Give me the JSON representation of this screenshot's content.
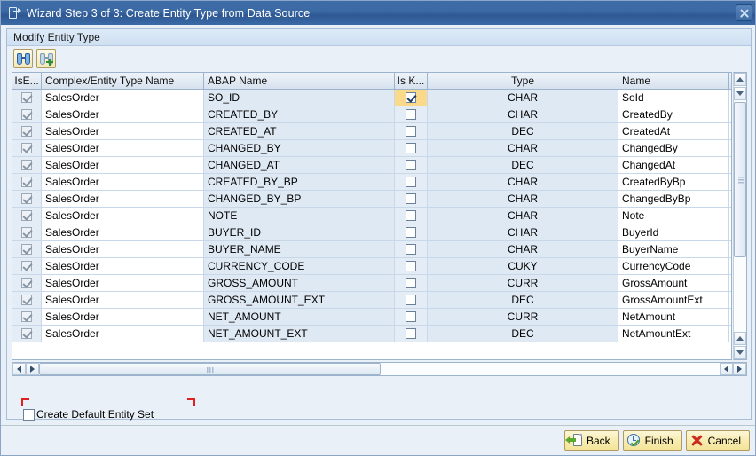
{
  "window": {
    "title": "Wizard Step 3 of 3: Create Entity Type from Data Source",
    "title_icon": "wizard-page-icon",
    "close_label": "×"
  },
  "panel": {
    "header": "Modify Entity Type"
  },
  "toolbar": {
    "buttons": [
      {
        "name": "find-button",
        "icon": "binoculars-icon",
        "tooltip": "Find"
      },
      {
        "name": "find-next-button",
        "icon": "binoculars-plus-icon",
        "tooltip": "Find Next"
      }
    ]
  },
  "grid": {
    "columns": [
      {
        "key": "is_entity",
        "label": "IsE...",
        "align": "center"
      },
      {
        "key": "complex_entity_type_name",
        "label": "Complex/Entity Type Name",
        "align": "left"
      },
      {
        "key": "abap_name",
        "label": "ABAP Name",
        "align": "left"
      },
      {
        "key": "is_key",
        "label": "Is K...",
        "align": "center"
      },
      {
        "key": "type",
        "label": "Type",
        "align": "center"
      },
      {
        "key": "name",
        "label": "Name",
        "align": "left"
      }
    ],
    "rows": [
      {
        "is_entity": true,
        "complex_entity_type_name": "SalesOrder",
        "abap_name": "SO_ID",
        "is_key": true,
        "type": "CHAR",
        "name": "SoId",
        "selected": true
      },
      {
        "is_entity": true,
        "complex_entity_type_name": "SalesOrder",
        "abap_name": "CREATED_BY",
        "is_key": false,
        "type": "CHAR",
        "name": "CreatedBy",
        "selected": false
      },
      {
        "is_entity": true,
        "complex_entity_type_name": "SalesOrder",
        "abap_name": "CREATED_AT",
        "is_key": false,
        "type": "DEC",
        "name": "CreatedAt",
        "selected": false
      },
      {
        "is_entity": true,
        "complex_entity_type_name": "SalesOrder",
        "abap_name": "CHANGED_BY",
        "is_key": false,
        "type": "CHAR",
        "name": "ChangedBy",
        "selected": false
      },
      {
        "is_entity": true,
        "complex_entity_type_name": "SalesOrder",
        "abap_name": "CHANGED_AT",
        "is_key": false,
        "type": "DEC",
        "name": "ChangedAt",
        "selected": false
      },
      {
        "is_entity": true,
        "complex_entity_type_name": "SalesOrder",
        "abap_name": "CREATED_BY_BP",
        "is_key": false,
        "type": "CHAR",
        "name": "CreatedByBp",
        "selected": false
      },
      {
        "is_entity": true,
        "complex_entity_type_name": "SalesOrder",
        "abap_name": "CHANGED_BY_BP",
        "is_key": false,
        "type": "CHAR",
        "name": "ChangedByBp",
        "selected": false
      },
      {
        "is_entity": true,
        "complex_entity_type_name": "SalesOrder",
        "abap_name": "NOTE",
        "is_key": false,
        "type": "CHAR",
        "name": "Note",
        "selected": false
      },
      {
        "is_entity": true,
        "complex_entity_type_name": "SalesOrder",
        "abap_name": "BUYER_ID",
        "is_key": false,
        "type": "CHAR",
        "name": "BuyerId",
        "selected": false
      },
      {
        "is_entity": true,
        "complex_entity_type_name": "SalesOrder",
        "abap_name": "BUYER_NAME",
        "is_key": false,
        "type": "CHAR",
        "name": "BuyerName",
        "selected": false
      },
      {
        "is_entity": true,
        "complex_entity_type_name": "SalesOrder",
        "abap_name": "CURRENCY_CODE",
        "is_key": false,
        "type": "CUKY",
        "name": "CurrencyCode",
        "selected": false
      },
      {
        "is_entity": true,
        "complex_entity_type_name": "SalesOrder",
        "abap_name": "GROSS_AMOUNT",
        "is_key": false,
        "type": "CURR",
        "name": "GrossAmount",
        "selected": false
      },
      {
        "is_entity": true,
        "complex_entity_type_name": "SalesOrder",
        "abap_name": "GROSS_AMOUNT_EXT",
        "is_key": false,
        "type": "DEC",
        "name": "GrossAmountExt",
        "selected": false
      },
      {
        "is_entity": true,
        "complex_entity_type_name": "SalesOrder",
        "abap_name": "NET_AMOUNT",
        "is_key": false,
        "type": "CURR",
        "name": "NetAmount",
        "selected": false
      },
      {
        "is_entity": true,
        "complex_entity_type_name": "SalesOrder",
        "abap_name": "NET_AMOUNT_EXT",
        "is_key": false,
        "type": "DEC",
        "name": "NetAmountExt",
        "selected": false
      }
    ]
  },
  "options": {
    "create_default_entity_set": {
      "label": "Create Default Entity Set",
      "checked": false
    }
  },
  "footer": {
    "buttons": [
      {
        "name": "back-button",
        "label": "Back",
        "icon": "page-back-icon"
      },
      {
        "name": "finish-button",
        "label": "Finish",
        "icon": "clock-check-icon"
      },
      {
        "name": "cancel-button",
        "label": "Cancel",
        "icon": "red-x-icon"
      }
    ]
  },
  "colors": {
    "titlebar": "#2e5894",
    "panel_bg": "#eaf0f8",
    "grid_row_alt": "#dfe9f4",
    "selected_cell": "#fbd98a",
    "focus_bracket": "#e02020",
    "button_yellow": "#f3e49a"
  }
}
